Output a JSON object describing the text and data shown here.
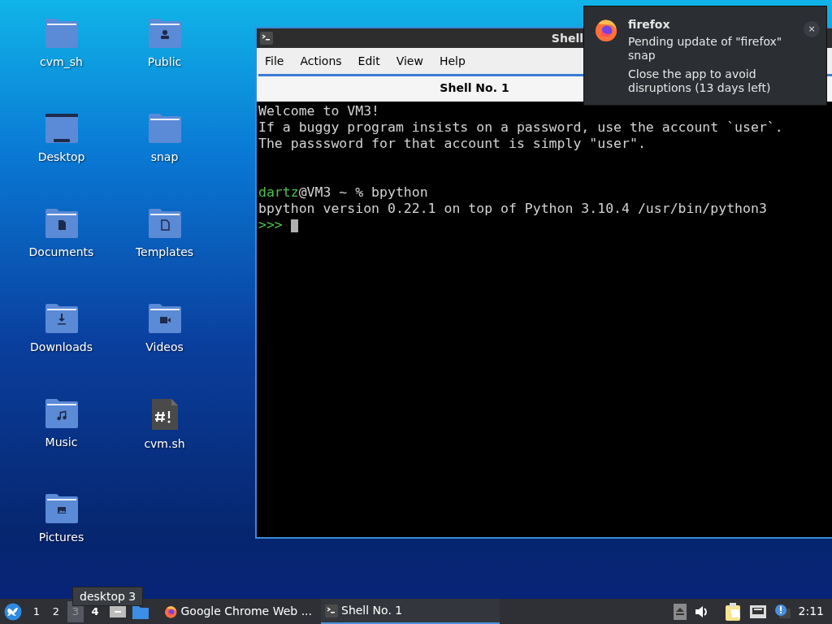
{
  "desktop_icons": [
    {
      "label": "cvm_sh",
      "kind": "folder"
    },
    {
      "label": "Public",
      "kind": "public"
    },
    {
      "label": "Desktop",
      "kind": "desktop"
    },
    {
      "label": "snap",
      "kind": "folder"
    },
    {
      "label": "Documents",
      "kind": "documents"
    },
    {
      "label": "Templates",
      "kind": "templates"
    },
    {
      "label": "Downloads",
      "kind": "downloads"
    },
    {
      "label": "Videos",
      "kind": "videos"
    },
    {
      "label": "Music",
      "kind": "music"
    },
    {
      "label": "cvm.sh",
      "kind": "script"
    },
    {
      "label": "Pictures",
      "kind": "pictures"
    }
  ],
  "window": {
    "title": "Shell",
    "menu": [
      "File",
      "Actions",
      "Edit",
      "View",
      "Help"
    ],
    "tab": {
      "label": "Shell No. 1",
      "selected": true
    },
    "lines": [
      {
        "kind": "text",
        "segments": [
          {
            "text": "Welcome to VM3!",
            "kind": "plain"
          }
        ]
      },
      {
        "kind": "text",
        "segments": [
          {
            "text": "If a buggy program insists on a password, use the account `user`.",
            "kind": "plain"
          }
        ]
      },
      {
        "kind": "text",
        "segments": [
          {
            "text": "The passsword for that account is simply \"user\".",
            "kind": "plain"
          }
        ]
      },
      {
        "kind": "blank"
      },
      {
        "kind": "blank"
      },
      {
        "kind": "text",
        "segments": [
          {
            "text": "dartz",
            "kind": "green"
          },
          {
            "text": "@VM3 ~ % bpython",
            "kind": "plain"
          }
        ]
      },
      {
        "kind": "text",
        "segments": [
          {
            "text": "bpython version 0.22.1 on top of Python 3.10.4 /usr/bin/python3",
            "kind": "plain"
          }
        ]
      },
      {
        "kind": "cursor",
        "segments": [
          {
            "text": ">>>",
            "kind": "green"
          }
        ]
      }
    ]
  },
  "notification": {
    "app": "firefox",
    "body": "Pending update of \"firefox\" snap",
    "detail": "Close the app to avoid disruptions (13 days left)",
    "close": "×"
  },
  "tooltip": "desktop 3",
  "taskbar": {
    "desktops": [
      {
        "label": "1",
        "selected": false
      },
      {
        "label": "2",
        "selected": false
      },
      {
        "label": "3",
        "selected": true
      },
      {
        "label": "4",
        "selected": false
      }
    ],
    "tasks": [
      {
        "label": "Google Chrome Web ...",
        "kind": "firefox",
        "selected": false
      },
      {
        "label": "Shell No. 1",
        "kind": "terminal",
        "selected": true
      }
    ],
    "clock": "2:11"
  }
}
